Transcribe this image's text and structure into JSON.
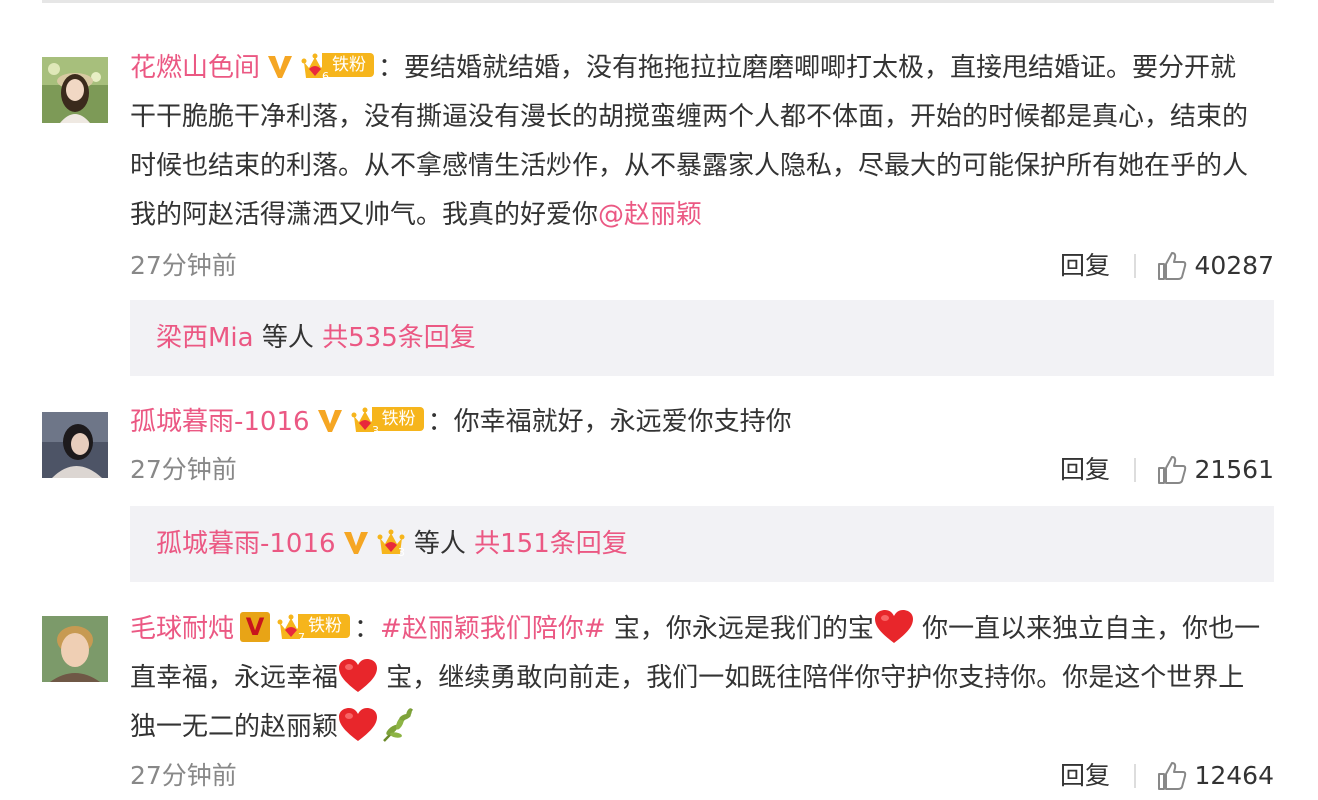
{
  "comments": [
    {
      "username": "花燃山色间",
      "fan_level": "6",
      "fan_label": "铁粉",
      "lines": [
        "要结婚就结婚，没有拖拖拉拉磨磨唧唧打太极，直接甩结婚证。要分开就",
        "干干脆脆干净利落，没有撕逼没有漫长的胡搅蛮缠两个人都不体面，开始的时候都是真心，结束的",
        "时候也结束的利落。从不拿感情生活炒作，从不暴露家人隐私，尽最大的可能保护所有她在乎的人",
        "我的阿赵活得潇洒又帅气。我真的好爱你"
      ],
      "mention": "@赵丽颖",
      "time": "27分钟前",
      "reply_label": "回复",
      "likes": "40287",
      "replies_summary": {
        "user": "梁西Mia",
        "middle": "等人",
        "count": "共535条回复"
      }
    },
    {
      "username": "孤城暮雨-1016",
      "fan_level": "3",
      "fan_label": "铁粉",
      "text": "你幸福就好，永远爱你支持你",
      "time": "27分钟前",
      "reply_label": "回复",
      "likes": "21561",
      "replies_summary": {
        "user": "孤城暮雨-1016",
        "fan_level": "3",
        "middle": "等人",
        "count": "共151条回复"
      }
    },
    {
      "username": "毛球耐炖",
      "fan_level": "7",
      "fan_label": "铁粉",
      "hashtag": "#赵丽颖我们陪你#",
      "seg1": "宝，你永远是我们的宝",
      "seg2": "你一直以来独立自主，你也一",
      "seg3": "直幸福，永远幸福",
      "seg4": "宝，继续勇敢向前走，我们一如既往陪伴你守护你支持你。你是这个世界上",
      "seg5": "独一无二的赵丽颖",
      "time": "27分钟前",
      "reply_label": "回复",
      "likes": "12464"
    }
  ],
  "colors": {
    "link": "#eb5883",
    "verified": "#f5a623",
    "fan_badge": "#f6b51c",
    "reply_bg": "#f2f2f5"
  },
  "icons": [
    "verified-v-icon",
    "crown-icon",
    "vip-v-icon",
    "heart-emoji",
    "olive-branch-emoji",
    "thumbs-up-icon"
  ]
}
